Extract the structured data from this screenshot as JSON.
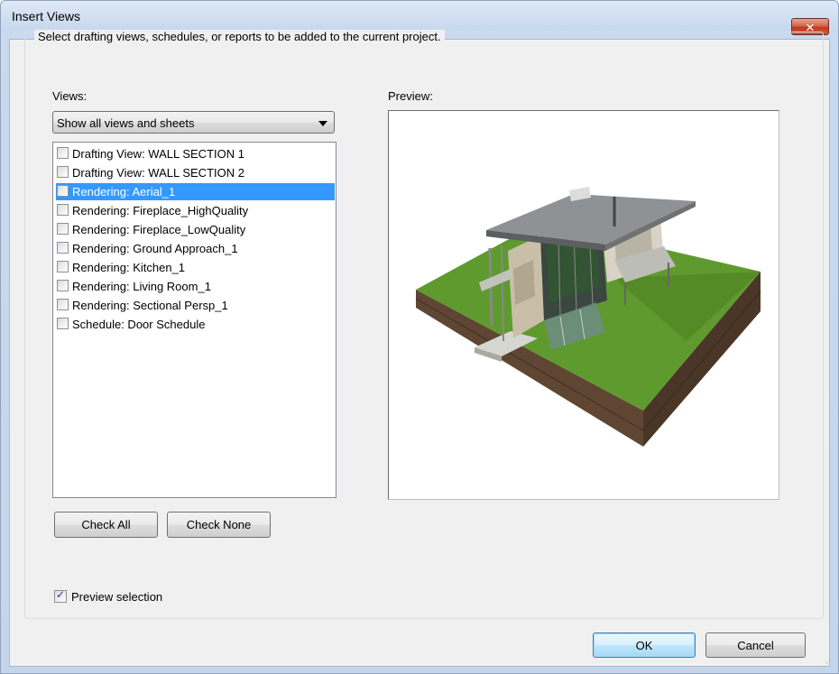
{
  "window": {
    "title": "Insert Views",
    "close_glyph": "✕"
  },
  "instruction": "Select drafting views, schedules, or reports to be added to the current project.",
  "views_label": "Views:",
  "preview_label": "Preview:",
  "filter": {
    "selected": "Show all views and sheets"
  },
  "views": [
    {
      "label": "Drafting View: WALL SECTION 1",
      "checked": false,
      "selected": false
    },
    {
      "label": "Drafting View: WALL SECTION 2",
      "checked": false,
      "selected": false
    },
    {
      "label": "Rendering: Aerial_1",
      "checked": false,
      "selected": true
    },
    {
      "label": "Rendering: Fireplace_HighQuality",
      "checked": false,
      "selected": false
    },
    {
      "label": "Rendering: Fireplace_LowQuality",
      "checked": false,
      "selected": false
    },
    {
      "label": "Rendering: Ground Approach_1",
      "checked": false,
      "selected": false
    },
    {
      "label": "Rendering: Kitchen_1",
      "checked": false,
      "selected": false
    },
    {
      "label": "Rendering: Living Room_1",
      "checked": false,
      "selected": false
    },
    {
      "label": "Rendering: Sectional Persp_1",
      "checked": false,
      "selected": false
    },
    {
      "label": "Schedule: Door Schedule",
      "checked": false,
      "selected": false
    }
  ],
  "buttons": {
    "check_all": "Check All",
    "check_none": "Check None",
    "ok": "OK",
    "cancel": "Cancel"
  },
  "preview_selection": {
    "label": "Preview selection",
    "checked": true
  },
  "colors": {
    "selection": "#3399ff",
    "grass": "#5f9a2e",
    "soil": "#5e4632"
  }
}
